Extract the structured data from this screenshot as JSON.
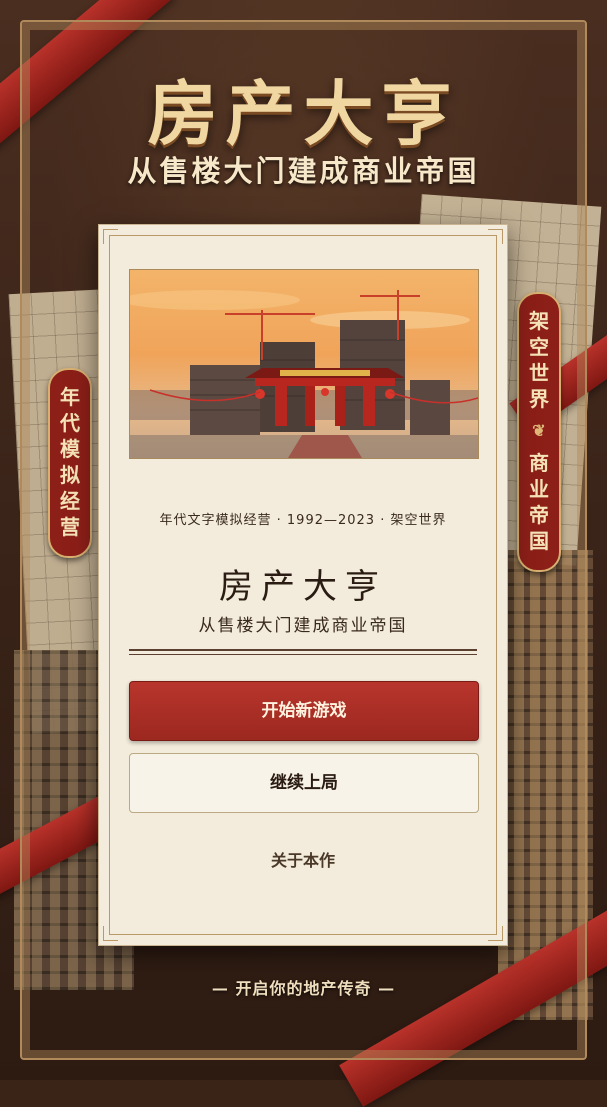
{
  "header": {
    "title": "房产大亨",
    "subtitle": "从售楼大门建成商业帝国"
  },
  "banners": {
    "left": "年代模拟经营",
    "right_top": "架空世界",
    "right_bottom": "商业帝国"
  },
  "card": {
    "caption": "年代文字模拟经营 · 1992—2023 · 架空世界",
    "title": "房产大亨",
    "subtitle": "从售楼大门建成商业帝国",
    "buttons": {
      "new_game": "开始新游戏",
      "continue": "继续上局"
    },
    "about_link": "关于本作"
  },
  "footer": {
    "tagline": "— 开启你的地产传奇 —"
  },
  "colors": {
    "accent_red": "#b8352c",
    "gold": "#f0d7a2",
    "paper": "#f3ecdc",
    "background": "#3a2418"
  },
  "icons": {
    "banner_ornament": "feather-ornament-icon"
  }
}
